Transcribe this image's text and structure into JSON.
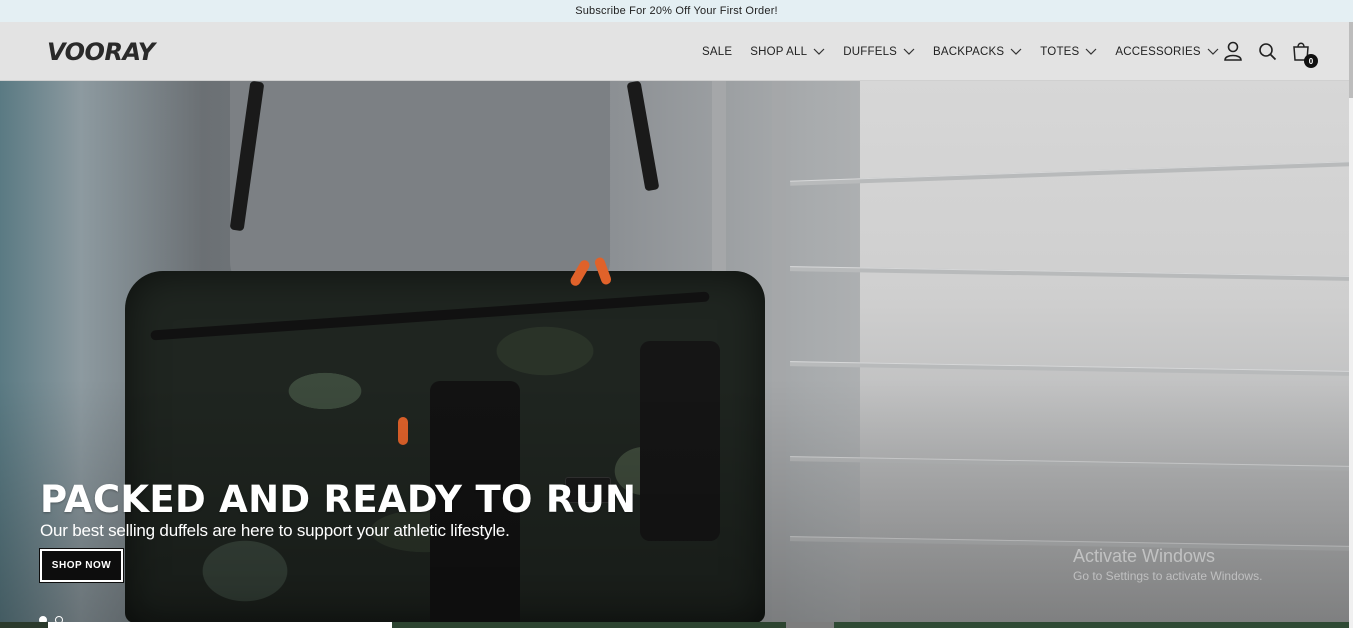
{
  "announcement": {
    "text": "Subscribe For 20% Off Your First Order!"
  },
  "header": {
    "logo": "VOORAY",
    "nav": [
      {
        "label": "SALE",
        "dropdown": false
      },
      {
        "label": "SHOP ALL",
        "dropdown": true
      },
      {
        "label": "DUFFELS",
        "dropdown": true
      },
      {
        "label": "BACKPACKS",
        "dropdown": true
      },
      {
        "label": "TOTES",
        "dropdown": true
      },
      {
        "label": "ACCESSORIES",
        "dropdown": true
      }
    ],
    "icons": [
      "account-icon",
      "search-icon",
      "cart-icon"
    ],
    "cart_count": "0"
  },
  "hero": {
    "title": "PACKED AND READY TO RUN",
    "subtitle": "Our best selling duffels are here to support your athletic lifestyle.",
    "cta_label": "SHOP NOW",
    "slide_count": 2,
    "active_slide": 1
  },
  "watermark": {
    "title": "Activate Windows",
    "subtitle": "Go to Settings to activate Windows."
  },
  "colors": {
    "announcement_bg": "#e4eff3",
    "header_bg": "#e3e3e3",
    "accent_dark": "#0d0d0d",
    "bag_pull": "#e0622a"
  }
}
